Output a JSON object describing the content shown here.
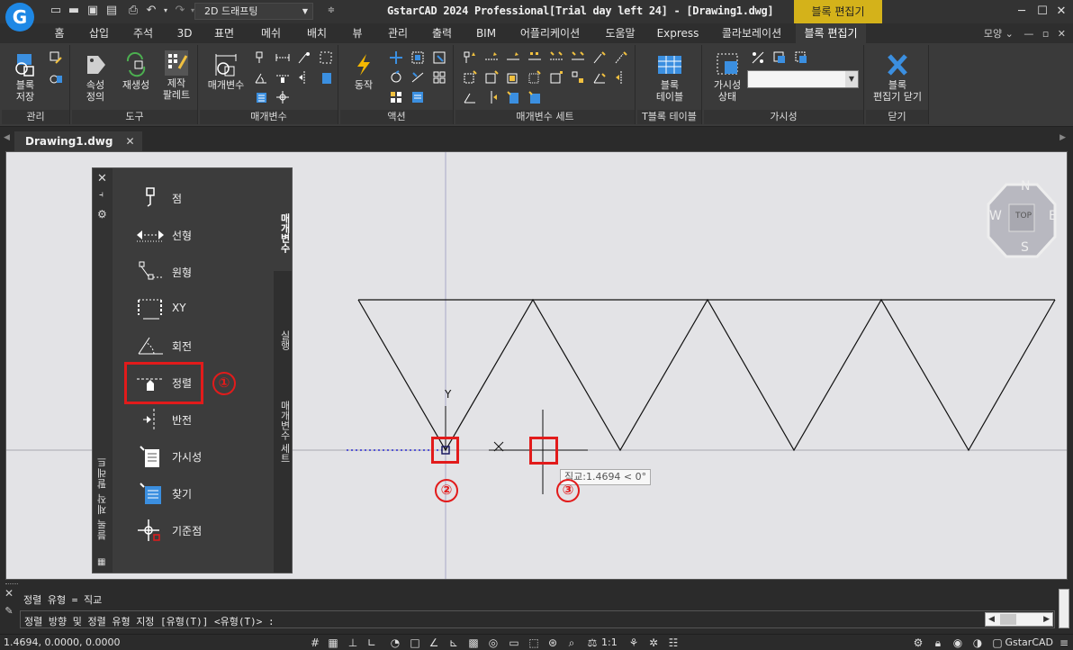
{
  "title_bar": {
    "workspace": "2D 드래프팅",
    "title": "GstarCAD 2024 Professional[Trial day left 24] - [Drawing1.dwg]",
    "context_tab": "블록 편집기",
    "logo_letter": "G"
  },
  "ribbon_tabs": [
    "홈",
    "삽입",
    "주석",
    "3D",
    "표면",
    "메쉬",
    "배치",
    "뷰",
    "관리",
    "출력",
    "BIM",
    "어플리케이션",
    "도움말",
    "Express",
    "콜라보레이션",
    "블록 편집기"
  ],
  "ribbon_tabs_right": "모양",
  "ribbon": {
    "manage": {
      "title": "관리",
      "save_block": "블록\n저장"
    },
    "tools": {
      "title": "도구",
      "attr_def": "속성\n정의",
      "regen": "재생성",
      "authoring_palette": "제작\n팔레트"
    },
    "params": {
      "title": "매개변수",
      "param_btn": "매개변수"
    },
    "actions": {
      "title": "액션",
      "action_btn": "동작"
    },
    "paramsets": {
      "title": "매개변수 세트"
    },
    "block_table": {
      "title": "T블록 테이블",
      "btn": "블록\n테이블"
    },
    "visibility": {
      "title": "가시성",
      "btn": "가시성\n상태",
      "combo_value": ""
    },
    "close": {
      "title": "닫기",
      "btn": "블록\n편집기 닫기"
    }
  },
  "document_tab": "Drawing1.dwg",
  "palette": {
    "vertical_title": "블록 제작 팔레트",
    "items": [
      "점",
      "선형",
      "원형",
      "XY",
      "회전",
      "정렬",
      "반전",
      "가시성",
      "찾기",
      "기준점"
    ],
    "side_tabs": [
      "매개변수",
      "실행",
      "매개변수 세트"
    ]
  },
  "canvas": {
    "ucs_y": "Y",
    "ucs_x": "X",
    "tooltip": "직교:1.4694 < 0°",
    "viewcube": {
      "top": "TOP",
      "n": "N",
      "s": "S",
      "e": "E",
      "w": "W"
    }
  },
  "annotations": [
    "①",
    "②",
    "③"
  ],
  "command": {
    "line1": "정렬 유형 = 직교",
    "line2": "정렬 방향 및 정렬 유형 지정 [유형(T)] <유형(T)> :"
  },
  "status": {
    "coords": "1.4694, 0.0000, 0.0000",
    "scale": "1:1",
    "brand": "GstarCAD"
  },
  "colors": {
    "accent_yellow": "#d4b21a",
    "annotation_red": "#e21b1b",
    "logo_blue": "#1e88e5",
    "icon_blue": "#3b8fe0"
  }
}
